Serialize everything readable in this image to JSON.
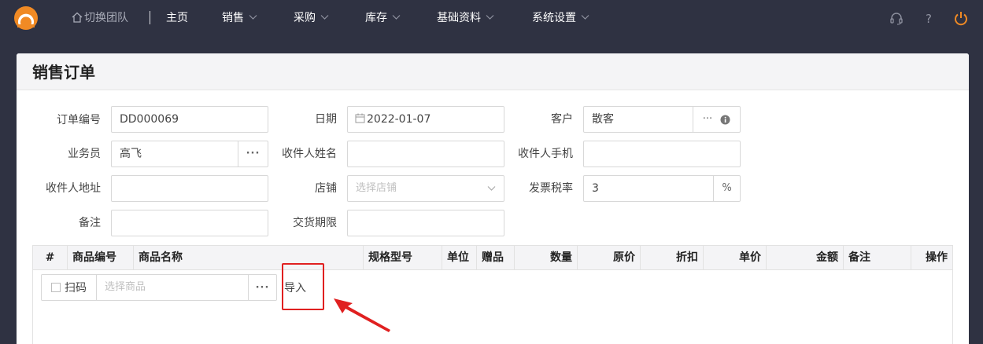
{
  "topbar": {
    "logo": "brand-logo",
    "switch_team": "切换团队",
    "nav": [
      {
        "label": "主页",
        "has_dropdown": false
      },
      {
        "label": "销售",
        "has_dropdown": true
      },
      {
        "label": "采购",
        "has_dropdown": true
      },
      {
        "label": "库存",
        "has_dropdown": true
      },
      {
        "label": "基础资料",
        "has_dropdown": true
      },
      {
        "label": "系统设置",
        "has_dropdown": true
      }
    ],
    "icons": [
      "headset-icon",
      "help-icon",
      "power-icon"
    ],
    "accent_color": "#f08a24",
    "bg_color": "#2f3242"
  },
  "page": {
    "title": "销售订单"
  },
  "form": {
    "order_no": {
      "label": "订单编号",
      "value": "DD000069"
    },
    "date": {
      "label": "日期",
      "value": "2022-01-07"
    },
    "customer": {
      "label": "客户",
      "value": "散客"
    },
    "salesperson": {
      "label": "业务员",
      "value": "高飞"
    },
    "receiver_name": {
      "label": "收件人姓名",
      "value": ""
    },
    "receiver_phone": {
      "label": "收件人手机",
      "value": ""
    },
    "receiver_address": {
      "label": "收件人地址",
      "value": ""
    },
    "store": {
      "label": "店铺",
      "placeholder": "选择店铺"
    },
    "tax_rate": {
      "label": "发票税率",
      "value": "3",
      "unit": "%"
    },
    "remark": {
      "label": "备注",
      "value": ""
    },
    "delivery_deadline": {
      "label": "交货期限",
      "value": ""
    }
  },
  "table": {
    "columns": [
      "#",
      "商品编号",
      "商品名称",
      "规格型号",
      "单位",
      "赠品",
      "数量",
      "原价",
      "折扣",
      "单价",
      "金额",
      "备注",
      "操作"
    ]
  },
  "entry": {
    "scan_label": "扫码",
    "product_placeholder": "选择商品",
    "dots": "···",
    "import_label": "导入"
  },
  "annotation": {
    "highlight_color": "#e02020"
  }
}
